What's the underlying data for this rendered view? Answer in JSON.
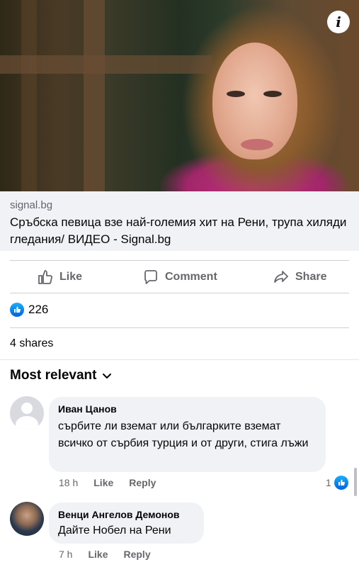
{
  "link_preview": {
    "domain": "signal.bg",
    "title": "Сръбска певица взе най-големия хит на Рени, трупа хиляди гледания/ ВИДЕО - Signal.bg",
    "info_icon": "info-icon"
  },
  "actions": {
    "like": "Like",
    "comment": "Comment",
    "share": "Share"
  },
  "reactions": {
    "count": "226",
    "icon": "like-reaction-icon",
    "color": "#1877f2"
  },
  "shares": "4 shares",
  "sort": {
    "label": "Most relevant"
  },
  "comments": [
    {
      "author": "Иван Цанов",
      "text": "сърбите ли вземат или българките вземат всичко от сърбия турция и от други, стига лъжи",
      "time": "18 h",
      "like": "Like",
      "reply": "Reply",
      "reactions": "1"
    },
    {
      "author": "Венци Ангелов Демонов",
      "text": "Дайте Нобел на Рени",
      "time": "7 h",
      "like": "Like",
      "reply": "Reply"
    }
  ]
}
